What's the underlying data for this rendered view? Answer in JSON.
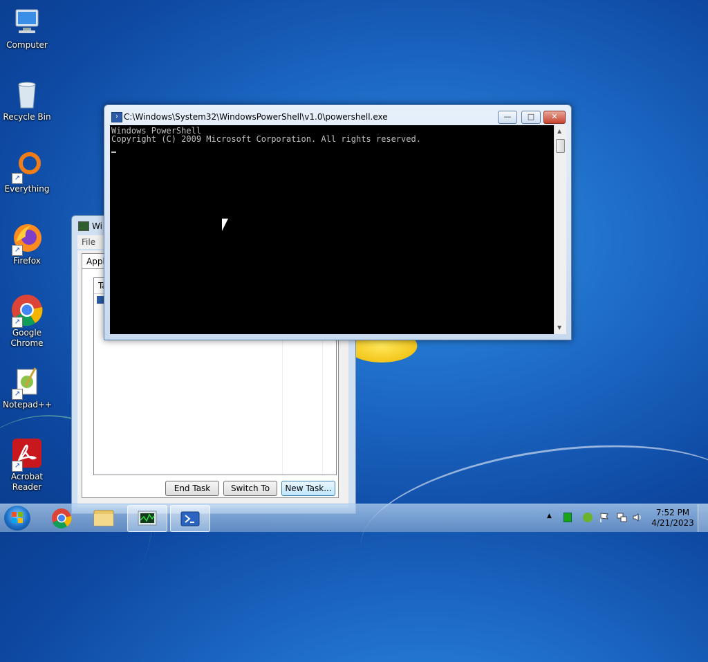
{
  "desktop": {
    "icons": [
      {
        "label": "Computer",
        "icon": "computer-icon"
      },
      {
        "label": "Recycle Bin",
        "icon": "recycle-bin-icon"
      },
      {
        "label": "Everything",
        "icon": "everything-icon"
      },
      {
        "label": "Firefox",
        "icon": "firefox-icon"
      },
      {
        "label": "Google Chrome",
        "icon": "chrome-icon"
      },
      {
        "label": "Notepad++",
        "icon": "notepadpp-icon"
      },
      {
        "label": "Acrobat Reader",
        "icon": "acrobat-icon"
      }
    ]
  },
  "task_manager": {
    "title": "Wi",
    "menu_file": "File",
    "tab": "Applic",
    "list_header": "Ta",
    "buttons": {
      "end_task": "End Task",
      "switch_to": "Switch To",
      "new_task": "New Task..."
    }
  },
  "powershell": {
    "title": "C:\\Windows\\System32\\WindowsPowerShell\\v1.0\\powershell.exe",
    "lines": [
      "Windows PowerShell",
      "Copyright (C) 2009 Microsoft Corporation. All rights reserved."
    ],
    "controls": {
      "minimize": "—",
      "maximize": "□",
      "close": "✕"
    }
  },
  "taskbar": {
    "clock_time": "7:52 PM",
    "clock_date": "4/21/2023",
    "tray_chevron": "▲"
  },
  "colors": {
    "console_bg": "#000000",
    "console_fg": "#c0c0c0",
    "taskbar": "#9ec0e6"
  }
}
